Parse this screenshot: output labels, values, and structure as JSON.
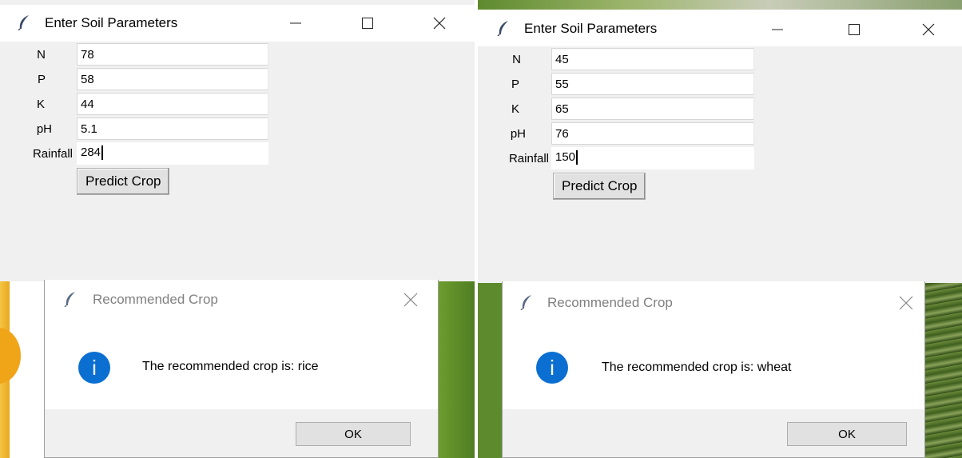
{
  "colors": {
    "window_bg": "#f0f0f0",
    "info_icon": "#0b6fd1",
    "dialog_title_gray": "#808080",
    "leaf_green": "#5e8a2e",
    "orange_fruit": "#f0a418"
  },
  "icons": {
    "app": "feather-icon",
    "minimize": "minimize-icon",
    "maximize": "maximize-icon",
    "close": "close-icon",
    "info": "info-icon"
  },
  "left": {
    "window": {
      "title": "Enter Soil Parameters",
      "fields": [
        {
          "label": "N",
          "value": "78"
        },
        {
          "label": "P",
          "value": "58"
        },
        {
          "label": "K",
          "value": "44"
        },
        {
          "label": "pH",
          "value": "5.1"
        },
        {
          "label": "Rainfall",
          "value": "284"
        }
      ],
      "button_label": "Predict Crop"
    },
    "dialog": {
      "title": "Recommended Crop",
      "info_glyph": "i",
      "message": "The recommended crop is: rice",
      "ok_label": "OK"
    }
  },
  "right": {
    "window": {
      "title": "Enter Soil Parameters",
      "fields": [
        {
          "label": "N",
          "value": "45"
        },
        {
          "label": "P",
          "value": "55"
        },
        {
          "label": "K",
          "value": "65"
        },
        {
          "label": "pH",
          "value": "76"
        },
        {
          "label": "Rainfall",
          "value": "150"
        }
      ],
      "button_label": "Predict Crop"
    },
    "dialog": {
      "title": "Recommended Crop",
      "info_glyph": "i",
      "message": "The recommended crop is: wheat",
      "ok_label": "OK"
    }
  }
}
